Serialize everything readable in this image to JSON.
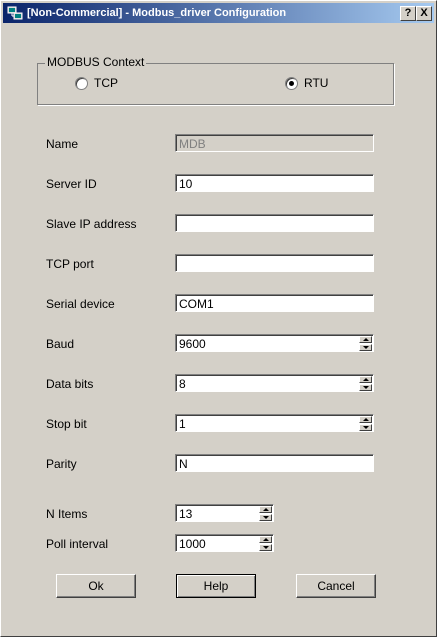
{
  "window": {
    "title": "[Non-Commercial] - Modbus_driver Configuration",
    "help_button": "?",
    "close_button": "X"
  },
  "context": {
    "group_label": "MODBUS Context",
    "tcp_label": "TCP",
    "rtu_label": "RTU",
    "selected": "RTU"
  },
  "fields": {
    "name": {
      "label": "Name",
      "value": "MDB"
    },
    "server_id": {
      "label": "Server ID",
      "value": "10"
    },
    "slave_ip": {
      "label": "Slave IP address",
      "value": ""
    },
    "tcp_port": {
      "label": "TCP port",
      "value": ""
    },
    "serial_device": {
      "label": "Serial device",
      "value": "COM1"
    },
    "baud": {
      "label": "Baud",
      "value": "9600"
    },
    "data_bits": {
      "label": "Data bits",
      "value": "8"
    },
    "stop_bit": {
      "label": "Stop bit",
      "value": "1"
    },
    "parity": {
      "label": "Parity",
      "value": "N"
    },
    "n_items": {
      "label": "N Items",
      "value": "13"
    },
    "poll_interval": {
      "label": "Poll interval",
      "value": "1000"
    }
  },
  "buttons": {
    "ok": "Ok",
    "help": "Help",
    "cancel": "Cancel"
  }
}
